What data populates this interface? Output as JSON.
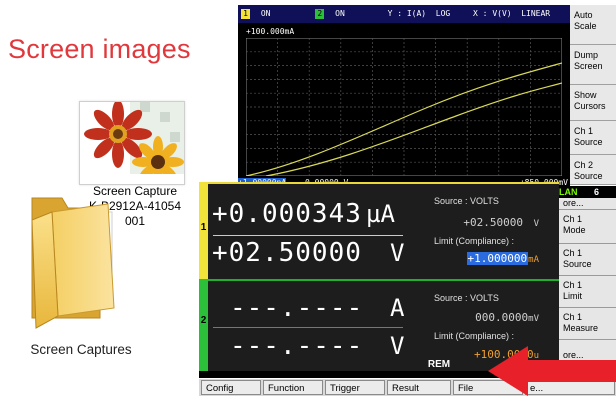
{
  "title": "Screen images",
  "thumbnail": {
    "icon": "flower-image-icon",
    "caption_line1": "Screen Capture",
    "caption_line2": "K-B2912A-41054",
    "caption_line3": "001"
  },
  "folder": {
    "icon": "folder-icon",
    "caption": "Screen Captures"
  },
  "graph_screen": {
    "ch1_num": "1",
    "ch1_state": "ON",
    "ch2_num": "2",
    "ch2_state": "ON",
    "y_axis": "Y : I(A)  LOG",
    "x_axis": "X : V(V)  LINEAR",
    "y_max": "+100.000mA",
    "y_min": "+1.00000nA",
    "x_min": "0.00000 V",
    "x_max": "+850.000mV",
    "colors": {
      "header": "#101058",
      "trace": "#d8d858",
      "grid": "#606060"
    },
    "softkeys": [
      {
        "line1": "Auto",
        "line2": "Scale"
      },
      {
        "line1": "Dump",
        "line2": "Screen"
      },
      {
        "line1": "Show",
        "line2": "Cursors"
      },
      {
        "line1": "Ch 1",
        "line2": "Source"
      },
      {
        "line1": "Ch 2",
        "line2": "Source"
      }
    ]
  },
  "meter_screen": {
    "ch1": {
      "num": "1",
      "measure_value": "+0.000343",
      "measure_unit": "µA",
      "source_value": "+02.50000",
      "source_unit": "V",
      "source_label": "Source :  VOLTS",
      "source_setting": "+02.50000",
      "source_setting_unit": "V",
      "limit_label": "Limit (Compliance) :",
      "limit_value": "+1.000000",
      "limit_unit": "mA"
    },
    "ch2": {
      "num": "2",
      "measure_value": "---.----",
      "measure_unit": "A",
      "source_value": "---.----",
      "source_unit": "V",
      "source_label": "Source :  VOLTS",
      "source_setting": "000.0000",
      "source_setting_unit": "mV",
      "limit_label": "Limit (Compliance) :",
      "limit_value": "+100.0000",
      "limit_unit": "u"
    },
    "status": "REM",
    "lan_label": "LAN",
    "lan_value": "6",
    "softkeys": [
      {
        "line1": "Ch 1",
        "line2": "Mode"
      },
      {
        "line1": "Ch 1",
        "line2": "Source"
      },
      {
        "line1": "Ch 1",
        "line2": "Limit"
      },
      {
        "line1": "Ch 1",
        "line2": "Measure"
      },
      {
        "line1": "ore...",
        "line2": ""
      }
    ],
    "more_top": "ore...",
    "function_keys": [
      "Config",
      "Function",
      "Trigger",
      "Result",
      "File",
      "e..."
    ]
  },
  "arrow_color": "#e8202a"
}
